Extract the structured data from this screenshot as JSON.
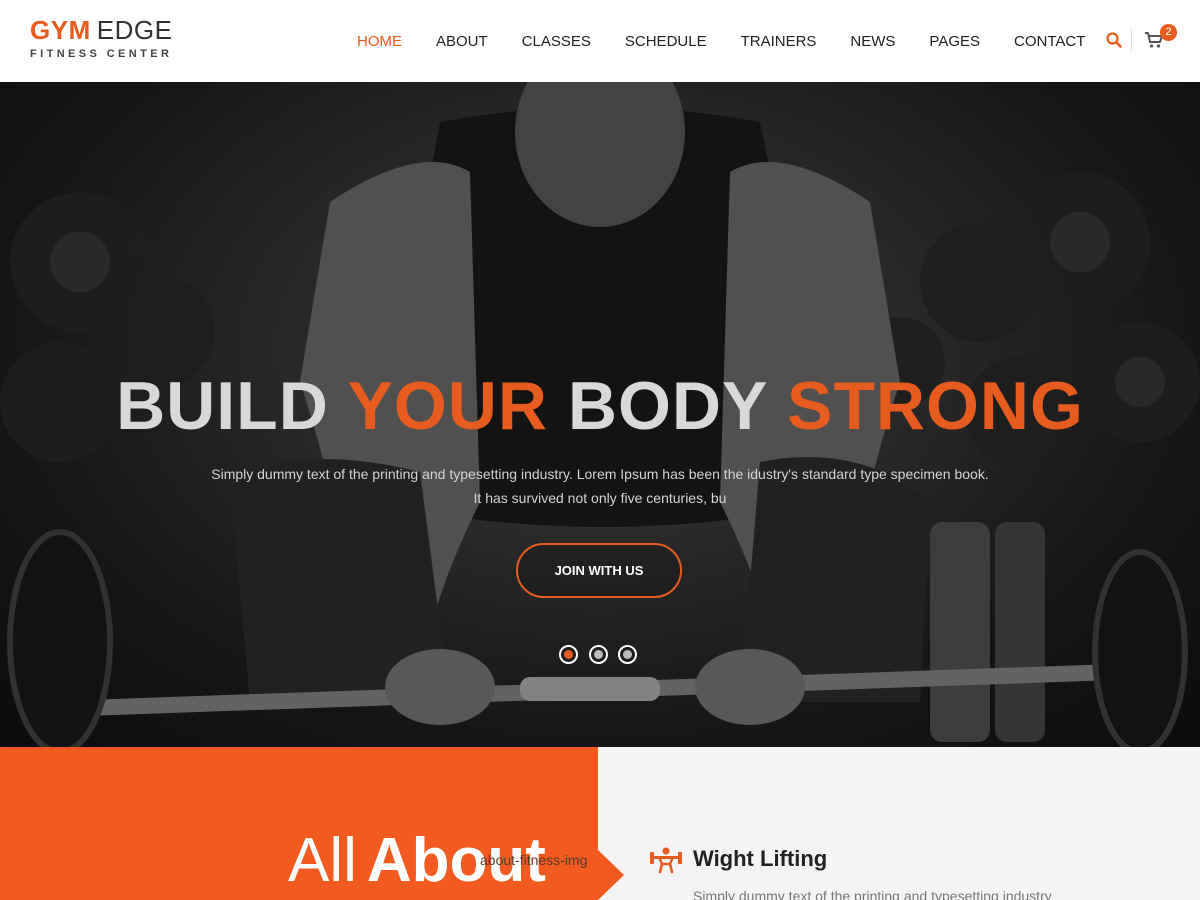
{
  "brand": {
    "name_part1": "GYM",
    "name_part2": "EDGE",
    "tagline": "FITNESS CENTER",
    "accent_color": "#e75b1e"
  },
  "nav": {
    "items": [
      {
        "label": "HOME",
        "active": true
      },
      {
        "label": "ABOUT",
        "active": false
      },
      {
        "label": "CLASSES",
        "active": false
      },
      {
        "label": "SCHEDULE",
        "active": false
      },
      {
        "label": "TRAINERS",
        "active": false
      },
      {
        "label": "NEWS",
        "active": false
      },
      {
        "label": "PAGES",
        "active": false
      },
      {
        "label": "CONTACT",
        "active": false
      }
    ],
    "search_icon": "search-icon",
    "cart_icon": "cart-icon",
    "cart_count": "2"
  },
  "hero": {
    "title_words": [
      {
        "text": "BUILD",
        "style": "light"
      },
      {
        "text": "YOUR",
        "style": "orange"
      },
      {
        "text": "BODY",
        "style": "light"
      },
      {
        "text": "STRONG",
        "style": "orange"
      }
    ],
    "text_line1": "Simply dummy text of the printing and typesetting industry. Lorem Ipsum has been the idustry's standard type specimen book.",
    "text_line2": "It has survived not only five centuries, bu",
    "button_label": "JOIN WITH US",
    "slides": 3,
    "active_slide": 1
  },
  "about": {
    "heading_thin": "All",
    "heading_bold": "About",
    "image_alt": "about-fitness-img",
    "feature": {
      "icon": "weightlifting-icon",
      "title": "Wight Lifting",
      "text": "Simply dummy text of the printing and typesetting industry"
    }
  }
}
